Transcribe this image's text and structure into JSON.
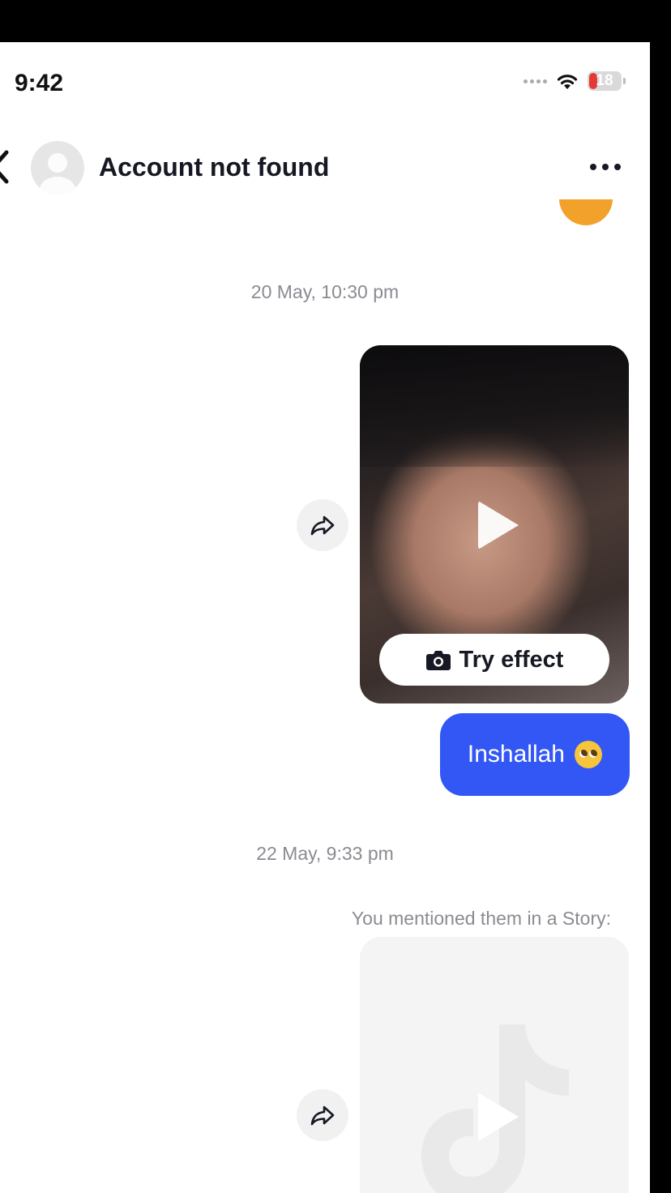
{
  "status_bar": {
    "time": "9:42",
    "battery": "18"
  },
  "header": {
    "title": "Account not found"
  },
  "messages": {
    "timestamp_1": "20 May, 10:30 pm",
    "try_effect_label": "Try effect",
    "bubble_text": "Inshallah",
    "timestamp_2": "22 May, 9:33 pm",
    "story_caption": "You mentioned them in a Story:"
  },
  "colors": {
    "bubble": "#3257f5",
    "battery_low": "#e53935",
    "timestamp_text": "#8a8b91"
  },
  "icons": [
    "back-chevron-icon",
    "avatar-placeholder-icon",
    "more-icon",
    "share-icon",
    "play-icon",
    "camera-icon",
    "pleading-face-emoji",
    "tiktok-logo-icon"
  ]
}
